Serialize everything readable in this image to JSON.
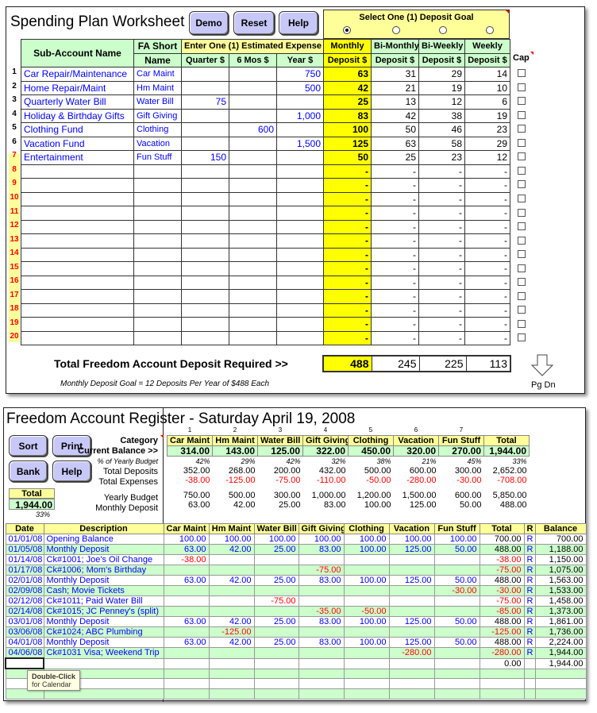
{
  "spending_plan": {
    "title": "Spending Plan Worksheet",
    "buttons": {
      "demo": "Demo",
      "reset": "Reset",
      "help": "Help"
    },
    "headers": {
      "sub_account": "Sub-Account Name",
      "fa_short_1": "FA Short",
      "fa_short_2": "Name",
      "estimated_expense": "Enter One (1) Estimated Expense",
      "quarter": "Quarter $",
      "six_mos": "6 Mos $",
      "year": "Year $",
      "deposit_goal": "Select One (1) Deposit Goal",
      "monthly_1": "Monthly",
      "bimonthly_1": "Bi-Monthly",
      "biweekly_1": "Bi-Weekly",
      "weekly_1": "Weekly",
      "deposit": "Deposit $",
      "cap": "Cap"
    },
    "selected_goal": "Monthly",
    "rows": [
      {
        "num": "1",
        "name": "Car Repair/Maintenance",
        "short": "Car Maint",
        "quarter": "",
        "six": "",
        "year": "750",
        "monthly": "63",
        "bimonthly": "31",
        "biweekly": "29",
        "weekly": "14",
        "cap": false
      },
      {
        "num": "2",
        "name": "Home Repair/Maint",
        "short": "Hm Maint",
        "quarter": "",
        "six": "",
        "year": "500",
        "monthly": "42",
        "bimonthly": "21",
        "biweekly": "19",
        "weekly": "10",
        "cap": false
      },
      {
        "num": "3",
        "name": "Quarterly Water Bill",
        "short": "Water Bill",
        "quarter": "75",
        "six": "",
        "year": "",
        "monthly": "25",
        "bimonthly": "13",
        "biweekly": "12",
        "weekly": "6",
        "cap": false
      },
      {
        "num": "4",
        "name": "Holiday & Birthday Gifts",
        "short": "Gift Giving",
        "quarter": "",
        "six": "",
        "year": "1,000",
        "monthly": "83",
        "bimonthly": "42",
        "biweekly": "38",
        "weekly": "19",
        "cap": false
      },
      {
        "num": "5",
        "name": "Clothing Fund",
        "short": "Clothing",
        "quarter": "",
        "six": "600",
        "year": "",
        "monthly": "100",
        "bimonthly": "50",
        "biweekly": "46",
        "weekly": "23",
        "cap": false
      },
      {
        "num": "6",
        "name": "Vacation Fund",
        "short": "Vacation",
        "quarter": "",
        "six": "",
        "year": "1,500",
        "monthly": "125",
        "bimonthly": "63",
        "biweekly": "58",
        "weekly": "29",
        "cap": false
      },
      {
        "num": "7",
        "name": "Entertainment",
        "short": "Fun Stuff",
        "quarter": "150",
        "six": "",
        "year": "",
        "monthly": "50",
        "bimonthly": "25",
        "biweekly": "23",
        "weekly": "12",
        "cap": false
      },
      {
        "num": "8",
        "name": "",
        "short": "",
        "quarter": "",
        "six": "",
        "year": "",
        "monthly": "-",
        "bimonthly": "-",
        "biweekly": "-",
        "weekly": "-",
        "cap": false
      },
      {
        "num": "9",
        "name": "",
        "short": "",
        "quarter": "",
        "six": "",
        "year": "",
        "monthly": "-",
        "bimonthly": "-",
        "biweekly": "-",
        "weekly": "-",
        "cap": false
      },
      {
        "num": "10",
        "name": "",
        "short": "",
        "quarter": "",
        "six": "",
        "year": "",
        "monthly": "-",
        "bimonthly": "-",
        "biweekly": "-",
        "weekly": "-",
        "cap": false
      },
      {
        "num": "11",
        "name": "",
        "short": "",
        "quarter": "",
        "six": "",
        "year": "",
        "monthly": "-",
        "bimonthly": "-",
        "biweekly": "-",
        "weekly": "-",
        "cap": false
      },
      {
        "num": "12",
        "name": "",
        "short": "",
        "quarter": "",
        "six": "",
        "year": "",
        "monthly": "-",
        "bimonthly": "-",
        "biweekly": "-",
        "weekly": "-",
        "cap": false
      },
      {
        "num": "13",
        "name": "",
        "short": "",
        "quarter": "",
        "six": "",
        "year": "",
        "monthly": "-",
        "bimonthly": "-",
        "biweekly": "-",
        "weekly": "-",
        "cap": false
      },
      {
        "num": "14",
        "name": "",
        "short": "",
        "quarter": "",
        "six": "",
        "year": "",
        "monthly": "-",
        "bimonthly": "-",
        "biweekly": "-",
        "weekly": "-",
        "cap": false
      },
      {
        "num": "15",
        "name": "",
        "short": "",
        "quarter": "",
        "six": "",
        "year": "",
        "monthly": "-",
        "bimonthly": "-",
        "biweekly": "-",
        "weekly": "-",
        "cap": false
      },
      {
        "num": "16",
        "name": "",
        "short": "",
        "quarter": "",
        "six": "",
        "year": "",
        "monthly": "-",
        "bimonthly": "-",
        "biweekly": "-",
        "weekly": "-",
        "cap": false
      },
      {
        "num": "17",
        "name": "",
        "short": "",
        "quarter": "",
        "six": "",
        "year": "",
        "monthly": "-",
        "bimonthly": "-",
        "biweekly": "-",
        "weekly": "-",
        "cap": false
      },
      {
        "num": "18",
        "name": "",
        "short": "",
        "quarter": "",
        "six": "",
        "year": "",
        "monthly": "-",
        "bimonthly": "-",
        "biweekly": "-",
        "weekly": "-",
        "cap": false
      },
      {
        "num": "19",
        "name": "",
        "short": "",
        "quarter": "",
        "six": "",
        "year": "",
        "monthly": "-",
        "bimonthly": "-",
        "biweekly": "-",
        "weekly": "-",
        "cap": false
      },
      {
        "num": "20",
        "name": "",
        "short": "",
        "quarter": "",
        "six": "",
        "year": "",
        "monthly": "-",
        "bimonthly": "-",
        "biweekly": "-",
        "weekly": "-",
        "cap": false
      }
    ],
    "total_label": "Total Freedom Account Deposit Required  >>",
    "totals": {
      "monthly": "488",
      "bimonthly": "245",
      "biweekly": "225",
      "weekly": "113"
    },
    "footnote": "Monthly Deposit Goal = 12 Deposits Per Year of $488 Each",
    "pgdn_label": "Pg Dn"
  },
  "register": {
    "title": "Freedom Account Register - ",
    "date": "Saturday April 19, 2008",
    "buttons": {
      "sort": "Sort",
      "print": "Print",
      "bank": "Bank",
      "help": "Help"
    },
    "total_box": {
      "label": "Total",
      "value": "1,944.00",
      "pct": "33%"
    },
    "summary_labels": {
      "category": "Category",
      "current_balance": "Current Balance >>",
      "pct_budget": "% of Yearly Budget",
      "total_deposits": "Total Deposits",
      "total_expenses": "Total Expenses",
      "yearly_budget": "Yearly Budget",
      "monthly_deposit": "Monthly Deposit"
    },
    "categories": [
      {
        "idx": "1",
        "name": "Car Maint",
        "balance": "314.00",
        "pct": "42%",
        "deposits": "352.00",
        "expenses": "-38.00",
        "budget": "750.00",
        "monthly": "63.00"
      },
      {
        "idx": "2",
        "name": "Hm Maint",
        "balance": "143.00",
        "pct": "29%",
        "deposits": "268.00",
        "expenses": "-125.00",
        "budget": "500.00",
        "monthly": "42.00"
      },
      {
        "idx": "3",
        "name": "Water Bill",
        "balance": "125.00",
        "pct": "42%",
        "deposits": "200.00",
        "expenses": "-75.00",
        "budget": "300.00",
        "monthly": "25.00"
      },
      {
        "idx": "4",
        "name": "Gift Giving",
        "balance": "322.00",
        "pct": "32%",
        "deposits": "432.00",
        "expenses": "-110.00",
        "budget": "1,000.00",
        "monthly": "83.00"
      },
      {
        "idx": "5",
        "name": "Clothing",
        "balance": "450.00",
        "pct": "38%",
        "deposits": "500.00",
        "expenses": "-50.00",
        "budget": "1,200.00",
        "monthly": "100.00"
      },
      {
        "idx": "6",
        "name": "Vacation",
        "balance": "320.00",
        "pct": "21%",
        "deposits": "600.00",
        "expenses": "-280.00",
        "budget": "1,500.00",
        "monthly": "125.00"
      },
      {
        "idx": "7",
        "name": "Fun Stuff",
        "balance": "270.00",
        "pct": "45%",
        "deposits": "300.00",
        "expenses": "-30.00",
        "budget": "600.00",
        "monthly": "50.00"
      },
      {
        "idx": "",
        "name": "Total",
        "balance": "1,944.00",
        "pct": "33%",
        "deposits": "2,652.00",
        "expenses": "-708.00",
        "budget": "5,850.00",
        "monthly": "488.00"
      }
    ],
    "columns": [
      "Date",
      "Description",
      "Car Maint",
      "Hm Maint",
      "Water Bill",
      "Gift Giving",
      "Clothing",
      "Vacation",
      "Fun Stuff",
      "Total",
      "R",
      "Balance"
    ],
    "transactions": [
      {
        "date": "01/01/08",
        "desc": "Opening Balance",
        "vals": [
          "100.00",
          "100.00",
          "100.00",
          "100.00",
          "100.00",
          "100.00",
          "100.00"
        ],
        "total": "700.00",
        "r": "R",
        "balance": "700.00"
      },
      {
        "date": "01/05/08",
        "desc": "Monthly Deposit",
        "vals": [
          "63.00",
          "42.00",
          "25.00",
          "83.00",
          "100.00",
          "125.00",
          "50.00"
        ],
        "total": "488.00",
        "r": "R",
        "balance": "1,188.00"
      },
      {
        "date": "01/14/08",
        "desc": "Ck#1001; Joe's Oil Change",
        "vals": [
          "-38.00",
          "",
          "",
          "",
          "",
          "",
          ""
        ],
        "total": "-38.00",
        "r": "R",
        "balance": "1,150.00"
      },
      {
        "date": "01/17/08",
        "desc": "Ck#1006; Mom's Birthday",
        "vals": [
          "",
          "",
          "",
          "-75.00",
          "",
          "",
          ""
        ],
        "total": "-75.00",
        "r": "R",
        "balance": "1,075.00"
      },
      {
        "date": "02/01/08",
        "desc": "Monthly Deposit",
        "vals": [
          "63.00",
          "42.00",
          "25.00",
          "83.00",
          "100.00",
          "125.00",
          "50.00"
        ],
        "total": "488.00",
        "r": "R",
        "balance": "1,563.00"
      },
      {
        "date": "02/09/08",
        "desc": "Cash; Movie Tickets",
        "vals": [
          "",
          "",
          "",
          "",
          "",
          "",
          "-30.00"
        ],
        "total": "-30.00",
        "r": "R",
        "balance": "1,533.00"
      },
      {
        "date": "02/12/08",
        "desc": "Ck#1011; Paid Water Bill",
        "vals": [
          "",
          "",
          "-75.00",
          "",
          "",
          "",
          ""
        ],
        "total": "-75.00",
        "r": "R",
        "balance": "1,458.00"
      },
      {
        "date": "02/14/08",
        "desc": "Ck#1015; JC Penney's (split)",
        "vals": [
          "",
          "",
          "",
          "-35.00",
          "-50.00",
          "",
          ""
        ],
        "total": "-85.00",
        "r": "R",
        "balance": "1,373.00"
      },
      {
        "date": "03/01/08",
        "desc": "Monthly Deposit",
        "vals": [
          "63.00",
          "42.00",
          "25.00",
          "83.00",
          "100.00",
          "125.00",
          "50.00"
        ],
        "total": "488.00",
        "r": "R",
        "balance": "1,861.00"
      },
      {
        "date": "03/06/08",
        "desc": "Ck#1024; ABC Plumbing",
        "vals": [
          "",
          "-125.00",
          "",
          "",
          "",
          "",
          ""
        ],
        "total": "-125.00",
        "r": "R",
        "balance": "1,736.00"
      },
      {
        "date": "04/01/08",
        "desc": "Monthly Deposit",
        "vals": [
          "63.00",
          "42.00",
          "25.00",
          "83.00",
          "100.00",
          "125.00",
          "50.00"
        ],
        "total": "488.00",
        "r": "R",
        "balance": "2,224.00"
      },
      {
        "date": "04/06/08",
        "desc": "Ck#1031 Visa; Weekend Trip",
        "vals": [
          "",
          "",
          "",
          "",
          "",
          "-280.00",
          ""
        ],
        "total": "-280.00",
        "r": "R",
        "balance": "1,944.00"
      },
      {
        "date": "",
        "desc": "",
        "vals": [
          "",
          "",
          "",
          "",
          "",
          "",
          ""
        ],
        "total": "0.00",
        "r": "",
        "balance": "1,944.00"
      },
      {
        "date": "",
        "desc": "",
        "vals": [
          "",
          "",
          "",
          "",
          "",
          "",
          ""
        ],
        "total": "",
        "r": "",
        "balance": ""
      },
      {
        "date": "",
        "desc": "",
        "vals": [
          "",
          "",
          "",
          "",
          "",
          "",
          ""
        ],
        "total": "",
        "r": "",
        "balance": ""
      },
      {
        "date": "",
        "desc": "",
        "vals": [
          "",
          "",
          "",
          "",
          "",
          "",
          ""
        ],
        "total": "",
        "r": "",
        "balance": ""
      }
    ],
    "tooltip": {
      "line1": "Double-Click",
      "line2": "for Calendar"
    }
  }
}
